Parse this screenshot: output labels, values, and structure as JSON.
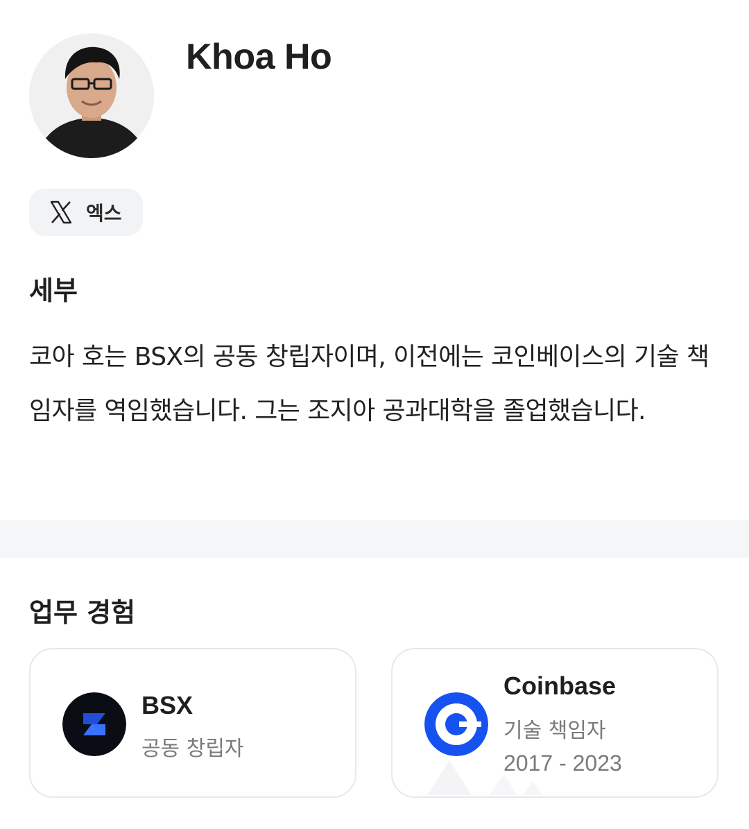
{
  "profile": {
    "name": "Khoa Ho",
    "social": {
      "label": "엑스",
      "icon": "x-logo-icon"
    }
  },
  "details": {
    "heading": "세부",
    "text": "코아 호는 BSX의 공동 창립자이며, 이전에는 코인베이스의 기술 책임자를 역임했습니다. 그는 조지아 공과대학을 졸업했습니다."
  },
  "work": {
    "heading": "업무 경험",
    "jobs": [
      {
        "company": "BSX",
        "role": "공동 창립자",
        "years": "",
        "logo": "bsx-logo-icon",
        "logo_color": "#1a57e8"
      },
      {
        "company": "Coinbase",
        "role": "기술 책임자",
        "years": "2017 - 2023",
        "logo": "coinbase-logo-icon",
        "logo_color": "#1652f0"
      }
    ]
  },
  "colors": {
    "divider": "#f5f6f8",
    "chip_bg": "#f2f3f5",
    "card_border": "#e7e8ea",
    "muted_text": "#7a7a7a"
  }
}
